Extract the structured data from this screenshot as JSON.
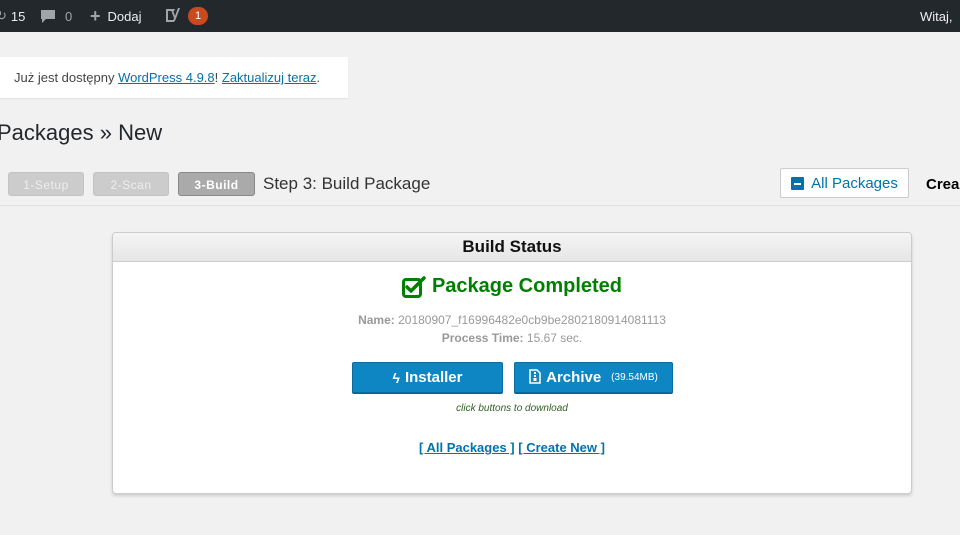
{
  "adminbar": {
    "updates_count": "15",
    "comments_count": "0",
    "new_label": "Dodaj",
    "yoast_badge": "1",
    "howdy": "Witaj,"
  },
  "notice": {
    "prefix": "Już jest dostępny ",
    "version_link": "WordPress 4.9.8",
    "middle": "! ",
    "update_link": "Zaktualizuj teraz",
    "suffix": "."
  },
  "page": {
    "title": "Packages » New"
  },
  "steps": {
    "step1": "1-Setup",
    "step2": "2-Scan",
    "step3": "3-Build",
    "current_title": "Step 3: Build Package",
    "all_packages_btn": "All Packages",
    "create_truncated": "Crea"
  },
  "build": {
    "header": "Build Status",
    "status": "Package Completed",
    "name_label": "Name:",
    "name_value": "20180907_f16996482e0cb9be2802180914081113",
    "time_label": "Process Time:",
    "time_value": "15.67 sec.",
    "installer_label": "Installer",
    "archive_label": "Archive",
    "archive_size": "(39.54MB)",
    "hint": "click buttons to download",
    "link_all": "[ All Packages ]",
    "link_create": "[ Create New ]"
  },
  "colors": {
    "adminbar_bg": "#23282d",
    "link": "#0073aa",
    "success": "#008000",
    "button_primary": "#0e86c4",
    "badge": "#ca4a1f"
  }
}
